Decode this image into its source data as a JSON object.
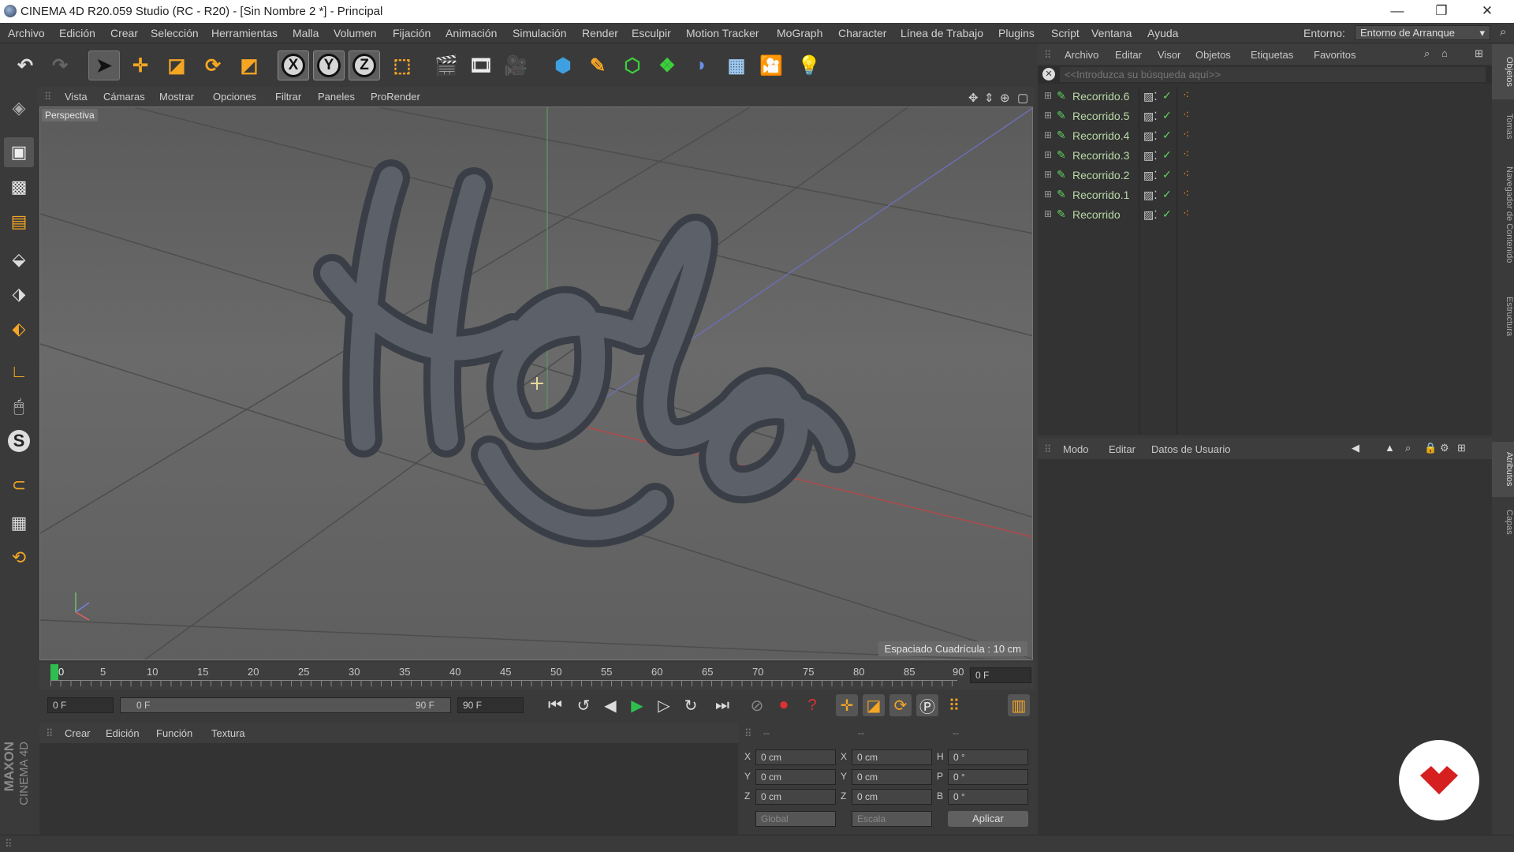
{
  "window": {
    "title": "CINEMA 4D R20.059 Studio (RC - R20) - [Sin Nombre 2 *] - Principal",
    "minimize": "—",
    "maximize": "❐",
    "close": "✕"
  },
  "menu": [
    "Archivo",
    "Edición",
    "Crear",
    "Selección",
    "Herramientas",
    "Malla",
    "Volumen",
    "Fijación",
    "Animación",
    "Simulación",
    "Render",
    "Esculpir",
    "Motion Tracker",
    "MoGraph",
    "Character",
    "Línea de Trabajo",
    "Plugins",
    "Script",
    "Ventana",
    "Ayuda"
  ],
  "environment": {
    "label": "Entorno:",
    "value": "Entorno de Arranque"
  },
  "viewport": {
    "menu": [
      "Vista",
      "Cámaras",
      "Mostrar",
      "Opciones",
      "Filtrar",
      "Paneles",
      "ProRender"
    ],
    "camera_label": "Perspectiva",
    "grid_spacing": "Espaciado Cuadrícula : 10 cm"
  },
  "timeline": {
    "ticks": [
      "0",
      "5",
      "10",
      "15",
      "20",
      "25",
      "30",
      "35",
      "40",
      "45",
      "50",
      "55",
      "60",
      "65",
      "70",
      "75",
      "80",
      "85",
      "90"
    ],
    "current": "0 F"
  },
  "transport": {
    "start": "0 F",
    "range_start": "0 F",
    "range_end": "90 F",
    "end": "90 F"
  },
  "material_menu": [
    "Crear",
    "Edición",
    "Función",
    "Textura"
  ],
  "coords": {
    "headers": [
      "--",
      "--",
      "--"
    ],
    "rows": [
      {
        "a": "X",
        "av": "0 cm",
        "b": "X",
        "bv": "0 cm",
        "c": "H",
        "cv": "0 °"
      },
      {
        "a": "Y",
        "av": "0 cm",
        "b": "Y",
        "bv": "0 cm",
        "c": "P",
        "cv": "0 °"
      },
      {
        "a": "Z",
        "av": "0 cm",
        "b": "Z",
        "bv": "0 cm",
        "c": "B",
        "cv": "0 °"
      }
    ],
    "mode1": "Global",
    "mode2": "Escala",
    "apply": "Aplicar"
  },
  "objects": {
    "menu": [
      "Archivo",
      "Editar",
      "Visor",
      "Objetos",
      "Etiquetas",
      "Favoritos"
    ],
    "search_placeholder": "<<Introduzca su búsqueda aquí>>",
    "items": [
      "Recorrido.6",
      "Recorrido.5",
      "Recorrido.4",
      "Recorrido.3",
      "Recorrido.2",
      "Recorrido.1",
      "Recorrido"
    ]
  },
  "attributes": {
    "menu": [
      "Modo",
      "Editar",
      "Datos de Usuario"
    ]
  },
  "right_tabs": [
    "Objetos",
    "Tomas",
    "Navegador de Contenido",
    "Estructura",
    "Atributos",
    "Capas"
  ],
  "brand": {
    "line1": "MAXON",
    "line2": "CINEMA 4D"
  }
}
